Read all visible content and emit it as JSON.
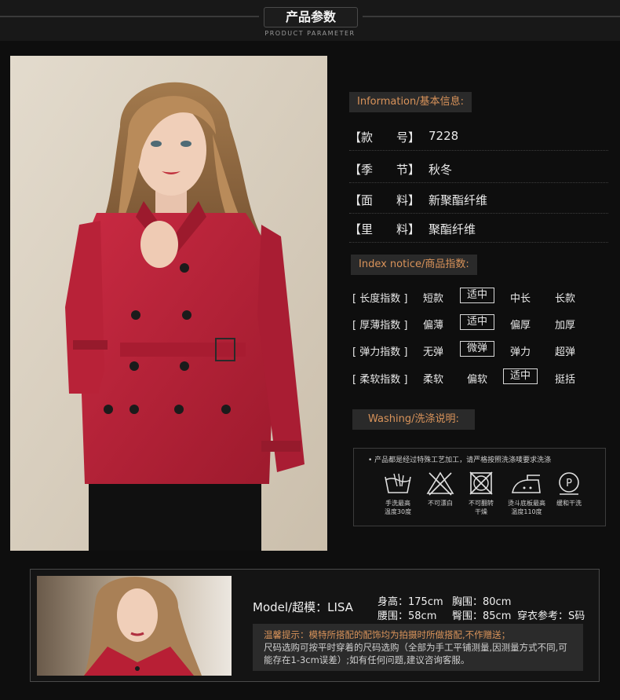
{
  "header": {
    "title": "产品参数",
    "subtitle": "PRODUCT PARAMETER"
  },
  "info": {
    "section_title": "Information/基本信息:",
    "rows": [
      {
        "key": "【款　　号】",
        "value": "7228"
      },
      {
        "key": "【季　　节】",
        "value": "秋冬"
      },
      {
        "key": "【面　　料】",
        "value": "新聚酯纤维"
      },
      {
        "key": "【里　　料】",
        "value": "聚酯纤维"
      }
    ]
  },
  "index": {
    "section_title": "Index notice/商品指数:",
    "rows": [
      {
        "label": "[ 长度指数 ]",
        "options": [
          "短款",
          "适中",
          "中长",
          "长款"
        ],
        "selected": 1
      },
      {
        "label": "[ 厚薄指数 ]",
        "options": [
          "偏薄",
          "适中",
          "偏厚",
          "加厚"
        ],
        "selected": 1
      },
      {
        "label": "[ 弹力指数 ]",
        "options": [
          "无弹",
          "微弹",
          "弹力",
          "超弹"
        ],
        "selected": 1
      },
      {
        "label": "[ 柔软指数 ]",
        "options": [
          "柔软",
          "偏软",
          "适中",
          "挺括"
        ],
        "selected": 2
      }
    ]
  },
  "washing": {
    "section_title": "Washing/洗涤说明:",
    "note": "• 产品都是经过特殊工艺加工，请严格按照洗涤唛要求洗涤",
    "icons": [
      {
        "icon": "hand-wash-icon",
        "label1": "手洗最高",
        "label2": "温度30度"
      },
      {
        "icon": "no-bleach-icon",
        "label1": "不可漂白",
        "label2": ""
      },
      {
        "icon": "no-tumble-dry-icon",
        "label1": "不可翻转",
        "label2": "干燥"
      },
      {
        "icon": "iron-icon",
        "label1": "烫斗底板最高",
        "label2": "温度110度"
      },
      {
        "icon": "dry-clean-icon",
        "label1": "缓和干洗",
        "label2": ""
      }
    ]
  },
  "model": {
    "name": "Model/超模：LISA",
    "height": "身高：175cm",
    "bust": "胸围：80cm",
    "waist": "腰围：58cm",
    "hip": "臀围：85cm",
    "size": "穿衣参考：S码",
    "tip_highlight": "温馨提示：模特所搭配的配饰均为拍摄时所做搭配,不作赠送；",
    "tip_text": "尺码选购可按平时穿着的尺码选购（全部为手工平铺测量,因测量方式不同,可能存在1-3cm误差）;如有任何问题,建议咨询客服。"
  },
  "colors": {
    "accent": "#d9935a",
    "coat": "#b81f35",
    "background": "#0e0e0e"
  }
}
